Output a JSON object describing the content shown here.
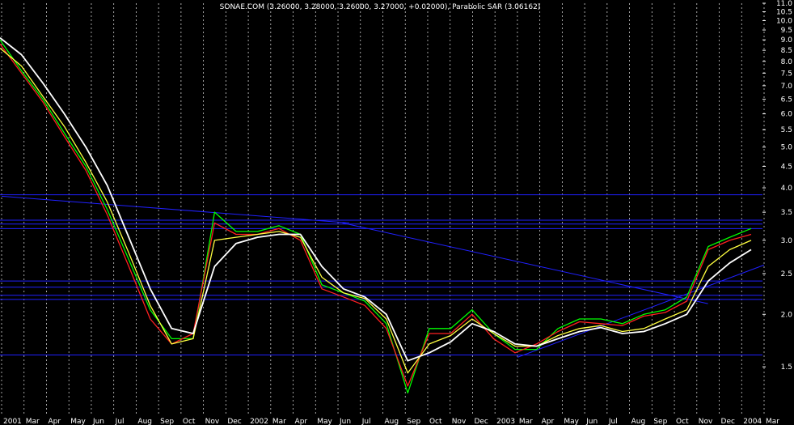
{
  "chart_data": {
    "type": "line",
    "title": "SONAE.COM (3.26000, 3.28000, 3.26000, 3.27000, +0.02000), Parabolic SAR (3.06162)",
    "y_scale": "log",
    "ylim": [
      1.15,
      11.0
    ],
    "y_ticks": [
      11.0,
      10.5,
      10.0,
      9.5,
      9.0,
      8.5,
      8.0,
      7.5,
      7.0,
      6.5,
      6.0,
      5.5,
      5.0,
      4.5,
      4.0,
      3.5,
      3.0,
      2.5,
      2.0,
      1.5
    ],
    "y_tick_labels": [
      "11.0",
      "10.5",
      "10.0",
      "9.5",
      "9.0",
      "8.5",
      "8.0",
      "7.5",
      "7.0",
      "6.5",
      "6.0",
      "5.5",
      "5.0",
      "4.5",
      "4.0",
      "3.5",
      "3.0",
      "2.5",
      "2.0",
      "1.5"
    ],
    "x_tick_labels": [
      "2001",
      "Mar",
      "Apr",
      "May",
      "Jun",
      "Jul",
      "Aug",
      "Sep",
      "Oct",
      "Nov",
      "Dec",
      "2002",
      "Mar",
      "Apr",
      "May",
      "Jun",
      "Jul",
      "Aug",
      "Sep",
      "Oct",
      "Nov",
      "Dec",
      "2003",
      "Mar",
      "Apr",
      "May",
      "Jun",
      "Jul",
      "Aug",
      "Sep",
      "Oct",
      "Nov",
      "Dec",
      "2004",
      "Mar"
    ],
    "grid": true,
    "horizontal_levels": [
      3.85,
      3.35,
      3.28,
      3.2,
      2.4,
      2.32,
      2.22,
      2.17,
      1.6
    ],
    "trendlines": [
      {
        "from": [
          0,
          3.82
        ],
        "to": [
          15.5,
          3.3
        ]
      },
      {
        "from": [
          15.2,
          3.3
        ],
        "to": [
          31.5,
          2.12
        ]
      },
      {
        "from": [
          23,
          1.58
        ],
        "to": [
          34,
          2.62
        ]
      }
    ],
    "series": [
      {
        "name": "",
        "color": "#00ff00",
        "values": [
          9.0,
          7.6,
          6.5,
          5.4,
          4.5,
          3.55,
          2.7,
          2.05,
          1.75,
          1.75,
          3.5,
          3.15,
          3.15,
          3.25,
          3.1,
          2.35,
          2.25,
          2.15,
          1.9,
          1.3,
          1.85,
          1.85,
          2.05,
          1.8,
          1.65,
          1.65,
          1.85,
          1.95,
          1.95,
          1.9,
          2.0,
          2.05,
          2.2,
          2.9,
          3.05,
          3.2
        ]
      },
      {
        "name": "",
        "color": "#ff2020",
        "values": [
          8.8,
          7.5,
          6.4,
          5.3,
          4.4,
          3.45,
          2.6,
          1.95,
          1.7,
          1.8,
          3.3,
          3.1,
          3.1,
          3.2,
          3.0,
          2.3,
          2.2,
          2.1,
          1.85,
          1.35,
          1.8,
          1.8,
          2.0,
          1.75,
          1.62,
          1.7,
          1.82,
          1.92,
          1.9,
          1.88,
          1.98,
          2.02,
          2.15,
          2.85,
          3.0,
          3.1
        ]
      },
      {
        "name": "",
        "color": "#ffff40",
        "values": [
          8.6,
          7.8,
          6.6,
          5.6,
          4.6,
          3.7,
          2.8,
          2.1,
          1.7,
          1.75,
          3.0,
          3.05,
          3.1,
          3.15,
          3.05,
          2.45,
          2.25,
          2.18,
          1.95,
          1.45,
          1.7,
          1.78,
          1.95,
          1.8,
          1.68,
          1.68,
          1.78,
          1.85,
          1.88,
          1.82,
          1.85,
          1.95,
          2.05,
          2.6,
          2.85,
          3.0
        ]
      },
      {
        "name": "",
        "color": "#ffffff",
        "values": [
          9.1,
          8.3,
          7.1,
          6.0,
          5.0,
          4.05,
          3.05,
          2.3,
          1.85,
          1.8,
          2.6,
          2.95,
          3.05,
          3.1,
          3.1,
          2.6,
          2.3,
          2.2,
          2.0,
          1.55,
          1.62,
          1.72,
          1.9,
          1.82,
          1.7,
          1.68,
          1.75,
          1.82,
          1.86,
          1.8,
          1.82,
          1.9,
          2.0,
          2.4,
          2.65,
          2.85
        ]
      }
    ]
  }
}
